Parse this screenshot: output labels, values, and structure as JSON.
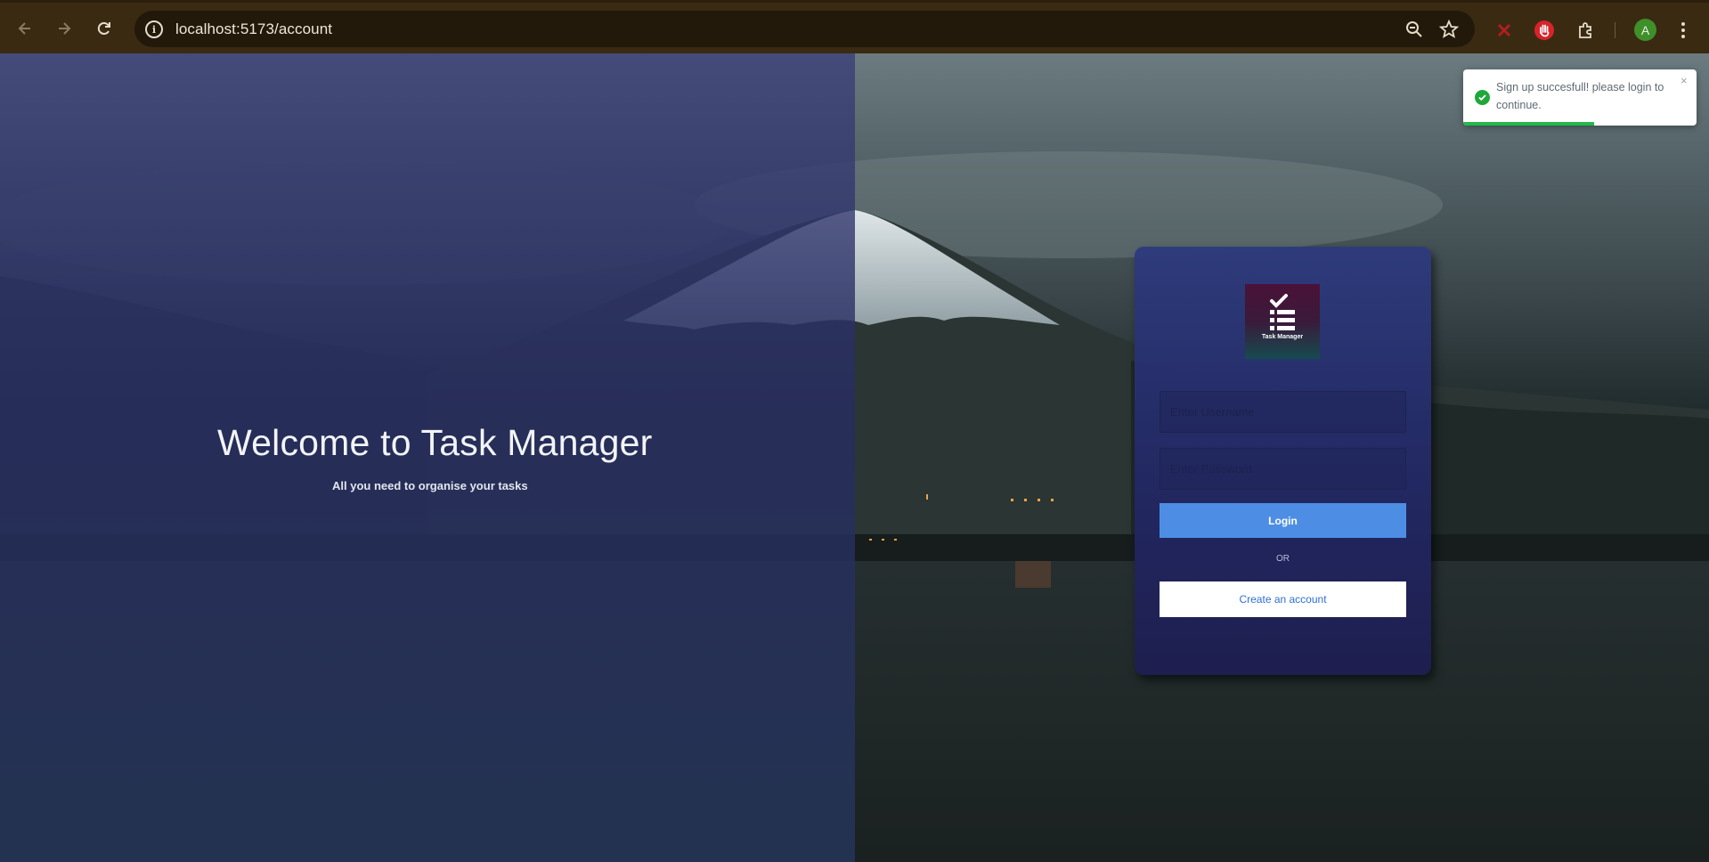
{
  "browser": {
    "url": "localhost:5173/account",
    "profile_initial": "A",
    "icons": {
      "back": "arrow-left-icon",
      "forward": "arrow-right-icon",
      "reload": "reload-icon",
      "site_info": "info-icon",
      "zoom": "zoom-out-icon",
      "bookmark": "star-icon",
      "extensions": "puzzle-icon"
    }
  },
  "hero": {
    "title": "Welcome to Task Manager",
    "subtitle": "All you need to organise your tasks"
  },
  "login": {
    "logo_text": "Task Manager",
    "username_placeholder": "Enter Username",
    "password_placeholder": "Enter Password",
    "login_label": "Login",
    "or_label": "OR",
    "create_label": "Create an account"
  },
  "toast": {
    "message": "Sign up succesfull! please login to continue.",
    "close": "×",
    "progress": 0.56
  },
  "colors": {
    "accent": "#4d8ee4",
    "success": "#1fa83a",
    "chrome": "#3a2a12"
  }
}
